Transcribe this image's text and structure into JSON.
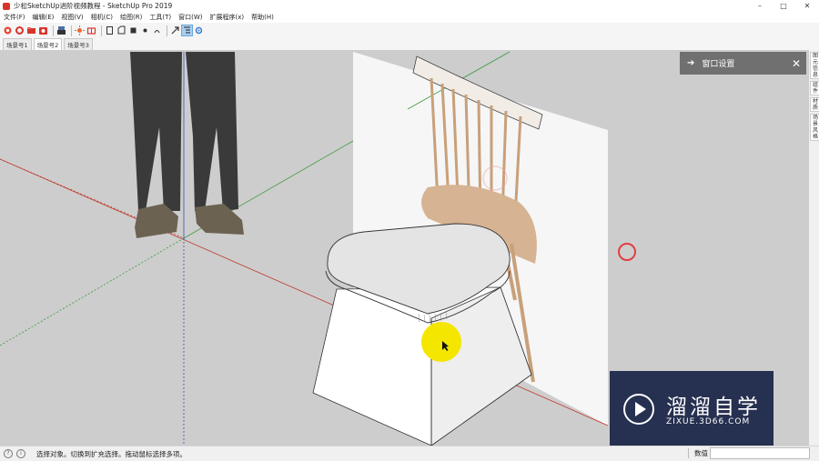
{
  "window": {
    "title": "少松SketchUp进阶视频教程 - SketchUp Pro 2019",
    "controls": {
      "minimize": "–",
      "maximize": "□",
      "close": "✕"
    }
  },
  "menubar": {
    "items": [
      "文件(F)",
      "编辑(E)",
      "视图(V)",
      "相机(C)",
      "绘图(R)",
      "工具(T)",
      "窗口(W)",
      "扩展程序(x)",
      "帮助(H)"
    ]
  },
  "toolbar": {
    "icons": [
      "select-tool-icon",
      "paint-tool-icon",
      "eraser-tool-icon",
      "camera-tool-icon",
      "print-icon",
      "sun-icon",
      "box-icon",
      "front-view-icon",
      "back-view-icon",
      "top-view-icon",
      "section-icon",
      "walk-icon",
      "arrow-icon",
      "outliner-icon",
      "gear-icon"
    ]
  },
  "scenes": {
    "tabs": [
      "场景号1",
      "场景号2",
      "场景号3"
    ],
    "active": 1
  },
  "tray": {
    "title": "窗口设置",
    "arrow": "➔",
    "close": "✕",
    "side_tabs": [
      "图元信息",
      "组件",
      "材质",
      "场景风格"
    ]
  },
  "statusbar": {
    "icons": [
      "?",
      "i"
    ],
    "hint": "选择对象。切换到扩充选择。拖动鼠标选择多项。",
    "measure_label": "数值",
    "measure_value": ""
  },
  "watermark": {
    "title": "溜溜自学",
    "url": "ZIXUE.3D66.COM"
  },
  "colors": {
    "viewport_bg": "#cdcdcd",
    "tray_header": "#707070",
    "watermark_bg": "#192346",
    "cursor_highlight": "#f5e600",
    "click_ring": "#e04040",
    "axis_red": "#c0392b",
    "axis_green": "#3c9a3c"
  }
}
